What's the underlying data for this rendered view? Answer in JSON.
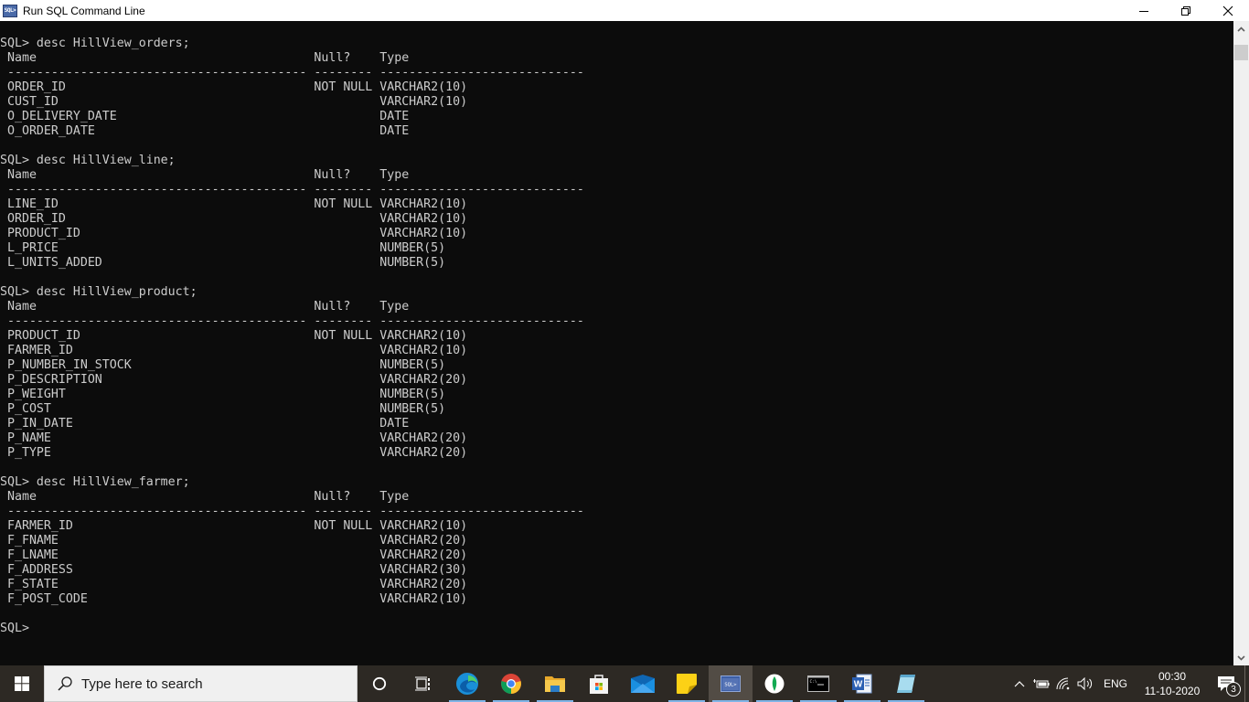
{
  "window": {
    "title": "Run SQL Command Line",
    "icon_label": "SQL>",
    "controls": [
      "minimize",
      "restore",
      "close"
    ]
  },
  "console": {
    "prompt": "SQL>",
    "blocks": [
      {
        "command": "desc HillView_orders;",
        "headers": {
          "name": "Name",
          "null": "Null?",
          "type": "Type"
        },
        "rows": [
          {
            "name": "ORDER_ID",
            "null": "NOT NULL",
            "type": "VARCHAR2(10)"
          },
          {
            "name": "CUST_ID",
            "null": "",
            "type": "VARCHAR2(10)"
          },
          {
            "name": "O_DELIVERY_DATE",
            "null": "",
            "type": "DATE"
          },
          {
            "name": "O_ORDER_DATE",
            "null": "",
            "type": "DATE"
          }
        ]
      },
      {
        "command": "desc HillView_line;",
        "headers": {
          "name": "Name",
          "null": "Null?",
          "type": "Type"
        },
        "rows": [
          {
            "name": "LINE_ID",
            "null": "NOT NULL",
            "type": "VARCHAR2(10)"
          },
          {
            "name": "ORDER_ID",
            "null": "",
            "type": "VARCHAR2(10)"
          },
          {
            "name": "PRODUCT_ID",
            "null": "",
            "type": "VARCHAR2(10)"
          },
          {
            "name": "L_PRICE",
            "null": "",
            "type": "NUMBER(5)"
          },
          {
            "name": "L_UNITS_ADDED",
            "null": "",
            "type": "NUMBER(5)"
          }
        ]
      },
      {
        "command": "desc HillView_product;",
        "headers": {
          "name": "Name",
          "null": "Null?",
          "type": "Type"
        },
        "rows": [
          {
            "name": "PRODUCT_ID",
            "null": "NOT NULL",
            "type": "VARCHAR2(10)"
          },
          {
            "name": "FARMER_ID",
            "null": "",
            "type": "VARCHAR2(10)"
          },
          {
            "name": "P_NUMBER_IN_STOCK",
            "null": "",
            "type": "NUMBER(5)"
          },
          {
            "name": "P_DESCRIPTION",
            "null": "",
            "type": "VARCHAR2(20)"
          },
          {
            "name": "P_WEIGHT",
            "null": "",
            "type": "NUMBER(5)"
          },
          {
            "name": "P_COST",
            "null": "",
            "type": "NUMBER(5)"
          },
          {
            "name": "P_IN_DATE",
            "null": "",
            "type": "DATE"
          },
          {
            "name": "P_NAME",
            "null": "",
            "type": "VARCHAR2(20)"
          },
          {
            "name": "P_TYPE",
            "null": "",
            "type": "VARCHAR2(20)"
          }
        ]
      },
      {
        "command": "desc HillView_farmer;",
        "headers": {
          "name": "Name",
          "null": "Null?",
          "type": "Type"
        },
        "rows": [
          {
            "name": "FARMER_ID",
            "null": "NOT NULL",
            "type": "VARCHAR2(10)"
          },
          {
            "name": "F_FNAME",
            "null": "",
            "type": "VARCHAR2(20)"
          },
          {
            "name": "F_LNAME",
            "null": "",
            "type": "VARCHAR2(20)"
          },
          {
            "name": "F_ADDRESS",
            "null": "",
            "type": "VARCHAR2(30)"
          },
          {
            "name": "F_STATE",
            "null": "",
            "type": "VARCHAR2(20)"
          },
          {
            "name": "F_POST_CODE",
            "null": "",
            "type": "VARCHAR2(10)"
          }
        ]
      }
    ],
    "final_prompt": "SQL>"
  },
  "taskbar": {
    "search_placeholder": "Type here to search",
    "apps": [
      {
        "name": "cortana",
        "icon": "circle-icon"
      },
      {
        "name": "task-view",
        "icon": "task-view-icon"
      },
      {
        "name": "edge",
        "icon": "edge-icon",
        "running": true
      },
      {
        "name": "chrome",
        "icon": "chrome-icon",
        "running": true
      },
      {
        "name": "file-explorer",
        "icon": "folder-icon",
        "running": true
      },
      {
        "name": "store",
        "icon": "store-icon"
      },
      {
        "name": "mail",
        "icon": "mail-icon"
      },
      {
        "name": "sticky-notes",
        "icon": "sticky-notes-icon",
        "running": true
      },
      {
        "name": "sql-command-line",
        "icon": "sql-icon",
        "running": true,
        "active": true
      },
      {
        "name": "mongodb",
        "icon": "mongodb-icon",
        "running": true
      },
      {
        "name": "command-prompt",
        "icon": "cmd-icon",
        "running": true
      },
      {
        "name": "word",
        "icon": "word-icon",
        "running": true
      },
      {
        "name": "notepad",
        "icon": "notepad-icon",
        "running": true
      }
    ],
    "tray": {
      "language": "ENG",
      "time": "00:30",
      "date": "11-10-2020",
      "notification_count": "3"
    }
  }
}
